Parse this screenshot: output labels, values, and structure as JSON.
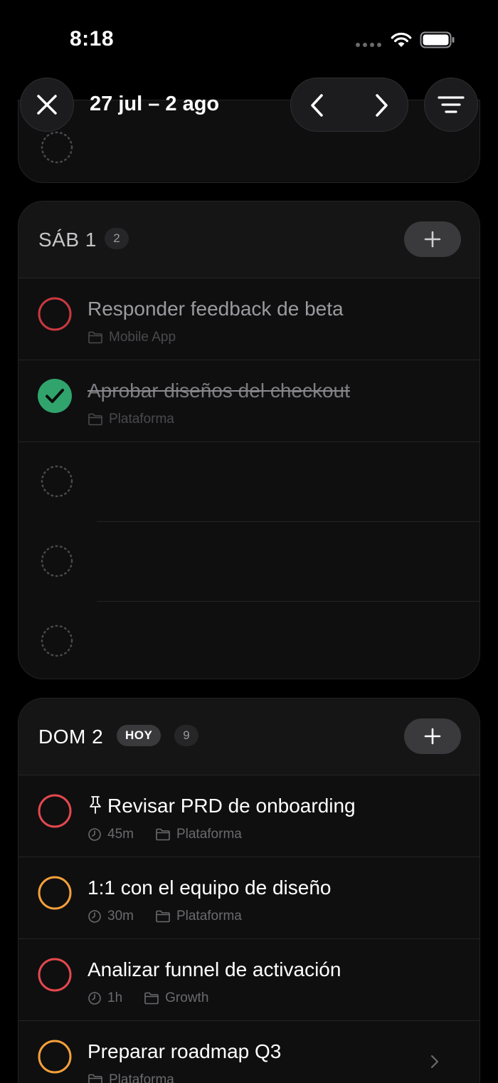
{
  "status_bar": {
    "time": "8:18"
  },
  "toolbar": {
    "date_range": "27 jul – 2 ago",
    "close_icon": "close-icon",
    "prev_icon": "chevron-left-icon",
    "next_icon": "chevron-right-icon",
    "menu_icon": "filter-menu-icon"
  },
  "days": [
    {
      "title": "SÁB 1",
      "count": "2",
      "tasks": [
        {
          "title": "Responder feedback de beta",
          "project": "Mobile App",
          "status": "open",
          "color": "#e5484d"
        },
        {
          "title": "Aprobar diseños del checkout",
          "project": "Plataforma",
          "status": "done",
          "color": "#30a46c"
        }
      ]
    },
    {
      "title": "DOM 2",
      "today_label": "HOY",
      "count": "9",
      "tasks": [
        {
          "title": "Revisar PRD de onboarding",
          "pinned": true,
          "duration": "45m",
          "project": "Plataforma",
          "color": "#e5484d"
        },
        {
          "title": "1:1 con el equipo de diseño",
          "duration": "30m",
          "project": "Plataforma",
          "color": "#f5a03a"
        },
        {
          "title": "Analizar funnel de activación",
          "duration": "1h",
          "project": "Growth",
          "color": "#e5484d"
        },
        {
          "title": "Preparar roadmap Q3",
          "project": "Plataforma",
          "color": "#f5a03a"
        }
      ]
    }
  ],
  "colors": {
    "background": "#000000",
    "card": "#0f0f10",
    "priority_high": "#e5484d",
    "priority_medium": "#f5a03a",
    "done": "#30a46c"
  }
}
